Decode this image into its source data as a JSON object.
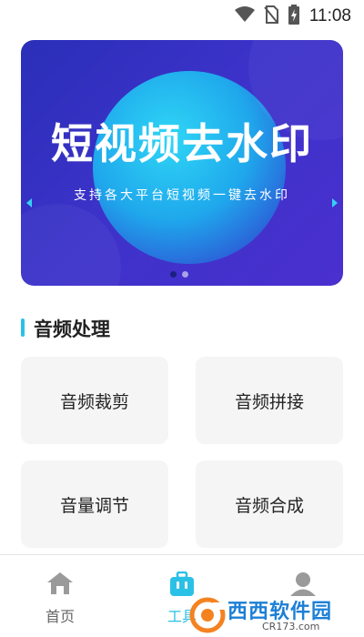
{
  "status_bar": {
    "time": "11:08",
    "icons": [
      "wifi-icon",
      "no-sim-icon",
      "battery-charging-icon"
    ]
  },
  "banner": {
    "title": "短视频去水印",
    "subtitle": "支持各大平台短视频一键去水印",
    "pagination_count": 2,
    "active_page": 1
  },
  "section": {
    "title": "音频处理"
  },
  "tools": [
    {
      "label": "音频裁剪"
    },
    {
      "label": "音频拼接"
    },
    {
      "label": "音量调节"
    },
    {
      "label": "音频合成"
    }
  ],
  "bottom_nav": {
    "items": [
      {
        "label": "首页",
        "icon": "home-icon",
        "active": false
      },
      {
        "label": "工具",
        "icon": "toolbox-icon",
        "active": true
      },
      {
        "label": "",
        "icon": "profile-icon",
        "active": false
      }
    ]
  },
  "watermark": {
    "text": "西西软件园",
    "url_text": "CR173.com"
  },
  "colors": {
    "accent": "#2bc1e6",
    "banner_bg": "#3c32c9",
    "card_bg": "#f5f5f5",
    "nav_inactive": "#9a9a9a",
    "watermark_orange": "#f58220"
  }
}
